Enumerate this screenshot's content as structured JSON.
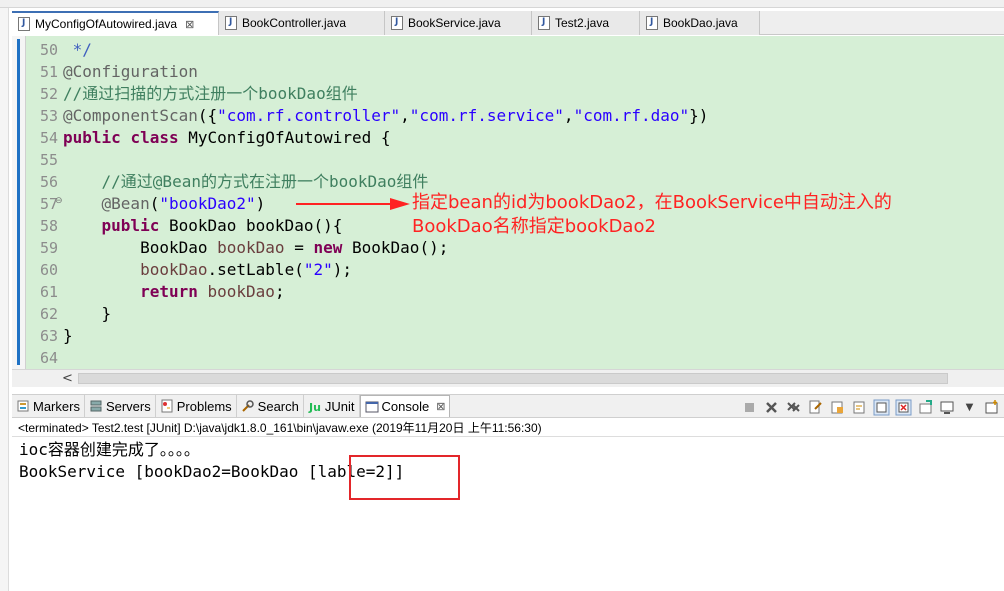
{
  "editor_tabs": [
    {
      "label": "MyConfigOfAutowired.java",
      "active": true,
      "close": "⊠"
    },
    {
      "label": "BookController.java",
      "active": false
    },
    {
      "label": "BookService.java",
      "active": false
    },
    {
      "label": "Test2.java",
      "active": false
    },
    {
      "label": "BookDao.java",
      "active": false
    }
  ],
  "line_numbers": [
    "50",
    "51",
    "52",
    "53",
    "54",
    "55",
    "56",
    "57",
    "58",
    "59",
    "60",
    "61",
    "62",
    "63",
    "64"
  ],
  "code": {
    "l50": " */",
    "l51": "@Configuration",
    "l52": "//通过扫描的方式注册一个bookDao组件",
    "l53_annot": "@ComponentScan",
    "l53_open": "({",
    "l53_s1": "\"com.rf.controller\"",
    "l53_s2": "\"com.rf.service\"",
    "l53_s3": "\"com.rf.dao\"",
    "l53_close": "})",
    "comma": ",",
    "l54_kw1": "public",
    "l54_kw2": "class",
    "l54_rest": " MyConfigOfAutowired {",
    "l56": "    //通过@Bean的方式在注册一个bookDao组件",
    "l57_annot": "    @Bean",
    "l57_open": "(",
    "l57_str": "\"bookDao2\"",
    "l57_close": ")",
    "l58_indent": "    ",
    "l58_kw": "public",
    "l58_rest": " BookDao bookDao(){",
    "l59_pre": "        BookDao ",
    "l59_var": "bookDao",
    "l59_mid": " = ",
    "l59_kw": "new",
    "l59_rest": " BookDao();",
    "l60_indent": "        ",
    "l60_var": "bookDao",
    "l60_mid": ".setLable(",
    "l60_str": "\"2\"",
    "l60_end": ");",
    "l61_indent": "        ",
    "l61_kw": "return",
    "l61_sp": " ",
    "l61_var": "bookDao",
    "l61_end": ";",
    "l62": "    }",
    "l63": "}"
  },
  "scroll_arrow": "<",
  "annotation": {
    "line1": "指定bean的id为bookDao2，在BookService中自动注入的",
    "line2": "BookDao名称指定bookDao2",
    "color": "#ff2222"
  },
  "view_tabs": [
    {
      "label": "Markers",
      "icon": "markers-icon"
    },
    {
      "label": "Servers",
      "icon": "servers-icon"
    },
    {
      "label": "Problems",
      "icon": "problems-icon"
    },
    {
      "label": "Search",
      "icon": "search-icon"
    },
    {
      "label": "JUnit",
      "icon": "junit-icon"
    },
    {
      "label": "Console",
      "icon": "console-icon",
      "active": true,
      "close": "⊠"
    }
  ],
  "console": {
    "header": "<terminated> Test2.test [JUnit] D:\\java\\jdk1.8.0_161\\bin\\javaw.exe (2019年11月20日 上午11:56:30)",
    "line1": "ioc容器创建完成了。。。。",
    "line2": "BookService [bookDao2=BookDao [lable=2]]"
  },
  "colors": {
    "editor_bg": "#d6efd6",
    "keyword": "#7f0055",
    "string": "#2a00ff",
    "comment": "#3f7f5f",
    "highlight_box": "#e3262a"
  }
}
